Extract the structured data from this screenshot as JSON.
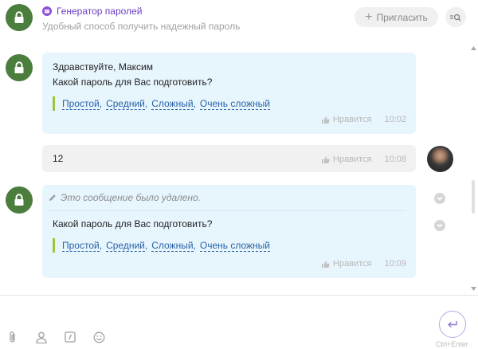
{
  "header": {
    "title": "Генератор паролей",
    "subtitle": "Удобный способ получить надежный пароль",
    "invite_label": "Пригласить"
  },
  "messages": [
    {
      "author": "bot",
      "lines": [
        "Здравствуйте, Максим",
        "Какой пароль для Вас подготовить?"
      ],
      "options": [
        "Простой",
        "Средний",
        "Сложный",
        "Очень сложный"
      ],
      "like_label": "Нравится",
      "time": "10:02"
    },
    {
      "author": "user",
      "text": "12",
      "like_label": "Нравится",
      "time": "10:08"
    },
    {
      "author": "bot",
      "deleted_text": "Это сообщение было удалено.",
      "lines": [
        "Какой пароль для Вас подготовить?"
      ],
      "options": [
        "Простой",
        "Средний",
        "Сложный",
        "Очень сложный"
      ],
      "like_label": "Нравится",
      "time": "10:09"
    }
  ],
  "composer": {
    "send_hint": "Ctrl+Enter"
  },
  "colors": {
    "bot_avatar": "#4b7d3c",
    "accent": "#6b3fc1",
    "bot_bubble": "#e7f5fd",
    "user_bubble": "#f1f1f1",
    "link": "#2a63a8",
    "quick_bar": "#9bc53d"
  },
  "icons": [
    "lock-icon",
    "bot-badge-icon",
    "plus-icon",
    "search-icon",
    "thumbs-up-icon",
    "pencil-icon",
    "chevron-down-icon",
    "paperclip-icon",
    "person-icon",
    "command-icon",
    "smile-icon",
    "send-icon"
  ]
}
